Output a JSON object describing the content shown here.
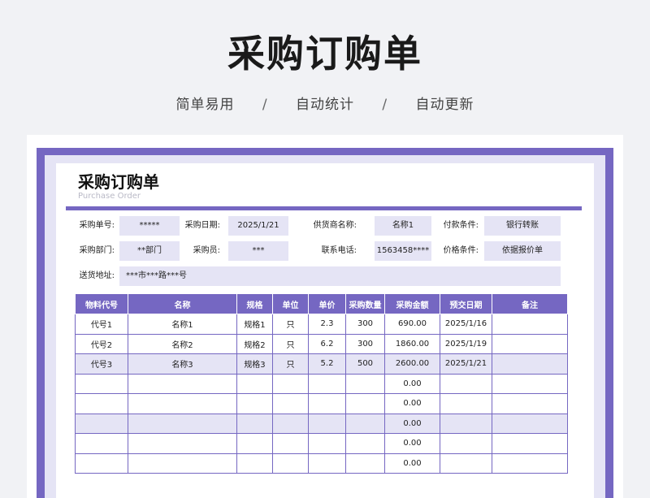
{
  "banner": {
    "title": "采购订购单",
    "tag1": "简单易用",
    "tag2": "自动统计",
    "tag3": "自动更新",
    "separator": "/"
  },
  "doc": {
    "title": "采购订购单",
    "subtitle": "Purchase Order"
  },
  "fields": {
    "order_no_label": "采购单号:",
    "order_no": "*****",
    "date_label": "采购日期:",
    "date": "2025/1/21",
    "supplier_label": "供货商名称:",
    "supplier": "名称1",
    "payment_label": "付款条件:",
    "payment": "银行转账",
    "dept_label": "采购部门:",
    "dept": "**部门",
    "buyer_label": "采购员:",
    "buyer": "***",
    "phone_label": "联系电话:",
    "phone": "1563458****",
    "price_label": "价格条件:",
    "price": "依据报价单",
    "address_label": "送货地址:",
    "address": "***市***路***号"
  },
  "table": {
    "headers": [
      "物料代号",
      "名称",
      "规格",
      "单位",
      "单价",
      "采购数量",
      "采购金额",
      "预交日期",
      "备注"
    ],
    "rows": [
      [
        "代号1",
        "名称1",
        "规格1",
        "只",
        "2.3",
        "300",
        "690.00",
        "2025/1/16",
        ""
      ],
      [
        "代号2",
        "名称2",
        "规格2",
        "只",
        "6.2",
        "300",
        "1860.00",
        "2025/1/19",
        ""
      ],
      [
        "代号3",
        "名称3",
        "规格3",
        "只",
        "5.2",
        "500",
        "2600.00",
        "2025/1/21",
        ""
      ],
      [
        "",
        "",
        "",
        "",
        "",
        "",
        "0.00",
        "",
        ""
      ],
      [
        "",
        "",
        "",
        "",
        "",
        "",
        "0.00",
        "",
        ""
      ],
      [
        "",
        "",
        "",
        "",
        "",
        "",
        "0.00",
        "",
        ""
      ],
      [
        "",
        "",
        "",
        "",
        "",
        "",
        "0.00",
        "",
        ""
      ],
      [
        "",
        "",
        "",
        "",
        "",
        "",
        "0.00",
        "",
        ""
      ]
    ]
  },
  "colors": {
    "accent": "#7567c2",
    "light": "#e5e4f5",
    "background": "#f1f2f5"
  }
}
